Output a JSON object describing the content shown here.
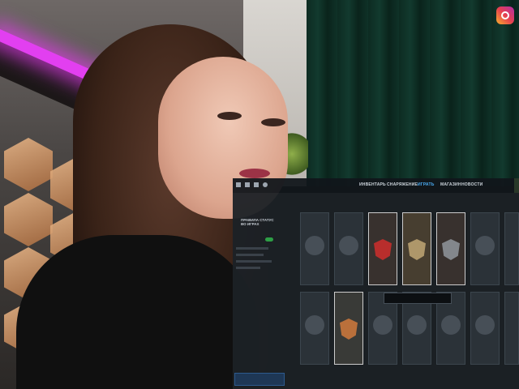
{
  "overlay": {
    "nav": {
      "inventory": "ИНВЕНТАРЬ",
      "equipment": "СНАРЯЖЕНИЕ",
      "games": "ИГРАТЬ",
      "shop": "МАГАЗИН",
      "news": "НОВОСТИ"
    },
    "sidebar_title": "ПРАВИЛА СТАТУС ВО ИГРАХ"
  },
  "colors": {
    "accent": "#4fb3ff",
    "toggle_on": "#2fa84a",
    "neon": "#e23ff0"
  },
  "icons": [
    "instagram-icon",
    "home-icon",
    "inventory-icon",
    "settings-icon",
    "gear-icon"
  ]
}
